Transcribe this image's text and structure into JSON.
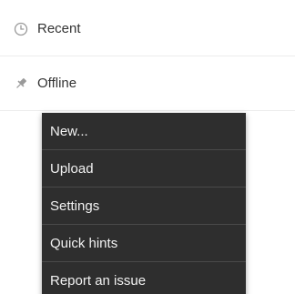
{
  "nav": {
    "items": [
      {
        "label": "Recent",
        "icon": "clock-icon"
      },
      {
        "label": "Offline",
        "icon": "pin-icon"
      }
    ]
  },
  "menu": {
    "items": [
      {
        "label": "New..."
      },
      {
        "label": "Upload"
      },
      {
        "label": "Settings"
      },
      {
        "label": "Quick hints"
      },
      {
        "label": "Report an issue"
      }
    ],
    "colors": {
      "background": "#2e2e2e",
      "text": "#f2f2f2",
      "divider": "#4a4a4a"
    }
  }
}
